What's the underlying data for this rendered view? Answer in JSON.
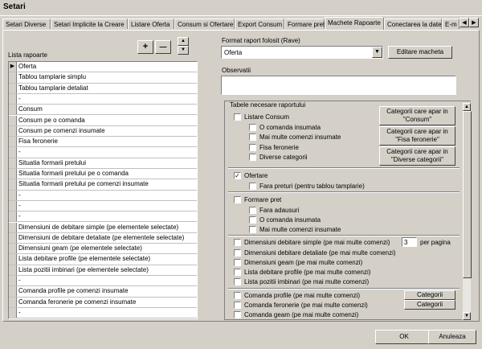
{
  "window": {
    "title": "Setari"
  },
  "tabs": [
    {
      "label": "Setari Diverse"
    },
    {
      "label": "Setari Implicite la Creare"
    },
    {
      "label": "Listare Oferta"
    },
    {
      "label": "Consum si Ofertare"
    },
    {
      "label": "Export Consum"
    },
    {
      "label": "Formare pret"
    },
    {
      "label": "Machete Rapoarte"
    },
    {
      "label": "Conectarea la date"
    },
    {
      "label": "E-m"
    }
  ],
  "left": {
    "list_label": "Lista rapoarte",
    "add_label": "+",
    "remove_label": "—",
    "rows": [
      "Oferta",
      "Tablou tamplarie simplu",
      "Tablou tamplarie detaliat",
      "-",
      "Consum",
      "Consum pe o comanda",
      "Consum pe comenzi insumate",
      "Fisa feronerie",
      "-",
      "Situatia formarii pretului",
      "Situatia formarii pretului pe o comanda",
      "Situatia formarii pretului pe comenzi insumate",
      "-",
      "-",
      "-",
      "Dimensiuni de debitare simple (pe elementele selectate)",
      "Dimensiuni de debitare detaliate (pe elementele selectate)",
      "Dimensiuni geam (pe elementele selectate)",
      "Lista debitare profile (pe elementele selectate)",
      "Lista pozitii imbinari (pe elementele selectate)",
      "-",
      "Comanda profile pe comenzi insumate",
      "Comanda feronerie pe comenzi insumate",
      "-"
    ]
  },
  "right": {
    "format_label": "Format raport folosit (Rave)",
    "format_value": "Oferta",
    "edit_button": "Editare macheta",
    "obs_label": "Observatii",
    "group_title": "Tabele necesare raportului",
    "listare_consum": "Listare Consum",
    "consum_opts": [
      "O comanda insumata",
      "Mai multe comenzi insumate",
      "Fisa feronerie",
      "Diverse categorii"
    ],
    "cat_btn1": [
      "Categorii care apar in",
      "\"Consum\""
    ],
    "cat_btn2": [
      "Categorii care apar in",
      "\"Fisa feronerie\""
    ],
    "cat_btn3": [
      "Categorii care apar in",
      "\"Diverse categorii\""
    ],
    "ofertare": "Ofertare",
    "ofertare_opt": "Fara preturi (pentru tablou tamplarie)",
    "formare_pret": "Formare pret",
    "formare_opts": [
      "Fara adausuri",
      "O comanda insumata",
      "Mai multe comenzi insumate"
    ],
    "dim_opts": [
      "Dimensiuni debitare simple (pe mai multe comenzi)",
      "Dimensiuni debitare detaliate (pe mai multe comenzi)",
      "Dimensiuni geam (pe mai multe comenzi)",
      "Lista debitare profile (pe mai multe comenzi)",
      "Lista pozitii imbinari (pe mai multe comenzi)"
    ],
    "per_page_value": "3",
    "per_page_label": "per pagina",
    "cmd_opts": [
      "Comanda profile (pe mai multe comenzi)",
      "Comanda feronerie (pe mai multe comenzi)",
      "Comanda geam (pe mai multe comenzi)"
    ],
    "categorii": "Categorii"
  },
  "footer": {
    "ok": "OK",
    "cancel": "Anuleaza"
  }
}
